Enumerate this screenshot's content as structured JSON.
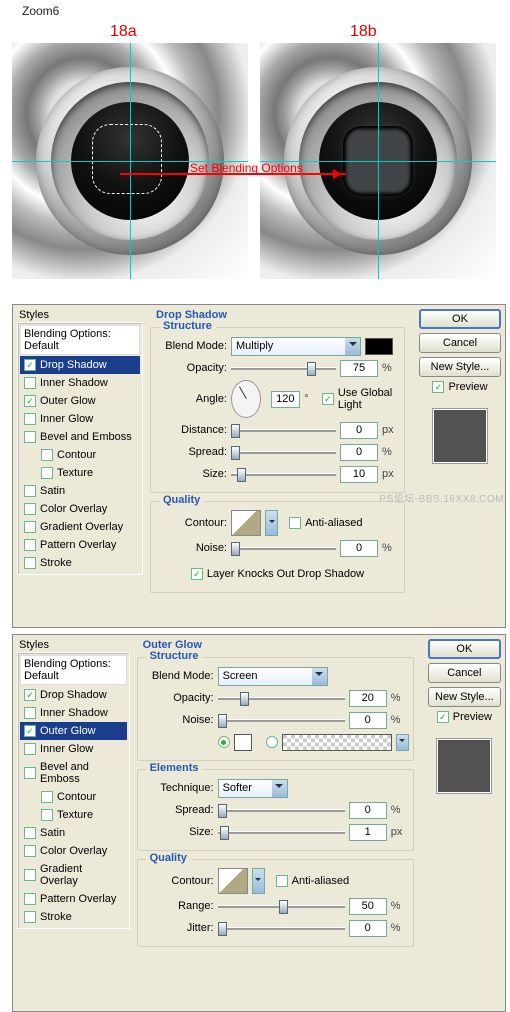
{
  "page": {
    "zoom_label": "Zoom6"
  },
  "figure": {
    "left_label": "18a",
    "right_label": "18b",
    "annotation": "Set Blending Options"
  },
  "styles_panel": {
    "title": "Styles",
    "blending_default": "Blending Options: Default",
    "items": {
      "drop_shadow": "Drop Shadow",
      "inner_shadow": "Inner Shadow",
      "outer_glow": "Outer Glow",
      "inner_glow": "Inner Glow",
      "bevel_emboss": "Bevel and Emboss",
      "contour": "Contour",
      "texture": "Texture",
      "satin": "Satin",
      "color_overlay": "Color Overlay",
      "gradient_overlay": "Gradient Overlay",
      "pattern_overlay": "Pattern Overlay",
      "stroke": "Stroke"
    }
  },
  "common": {
    "structure_title": "Structure",
    "elements_title": "Elements",
    "quality_title": "Quality",
    "blend_mode_label": "Blend Mode:",
    "opacity_label": "Opacity:",
    "angle_label": "Angle:",
    "use_global_light": "Use Global Light",
    "distance_label": "Distance:",
    "spread_label": "Spread:",
    "size_label": "Size:",
    "contour_label": "Contour:",
    "anti_aliased": "Anti-aliased",
    "noise_label": "Noise:",
    "layer_knocks": "Layer Knocks Out Drop Shadow",
    "technique_label": "Technique:",
    "range_label": "Range:",
    "jitter_label": "Jitter:",
    "pct": "%",
    "px": "px",
    "deg": "°"
  },
  "drop_shadow": {
    "title": "Drop Shadow",
    "blend_mode": "Multiply",
    "color": "#000000",
    "opacity": "75",
    "angle": "120",
    "use_global_light": true,
    "distance": "0",
    "spread": "0",
    "size": "10",
    "noise": "0"
  },
  "outer_glow": {
    "title": "Outer Glow",
    "blend_mode": "Screen",
    "opacity": "20",
    "noise": "0",
    "glow_color": "#ffffff",
    "technique": "Softer",
    "spread": "0",
    "size": "1",
    "range": "50",
    "jitter": "0"
  },
  "buttons": {
    "ok": "OK",
    "cancel": "Cancel",
    "new_style": "New Style...",
    "preview": "Preview"
  },
  "watermark": "PS论坛-BBS.16XX8.COM"
}
